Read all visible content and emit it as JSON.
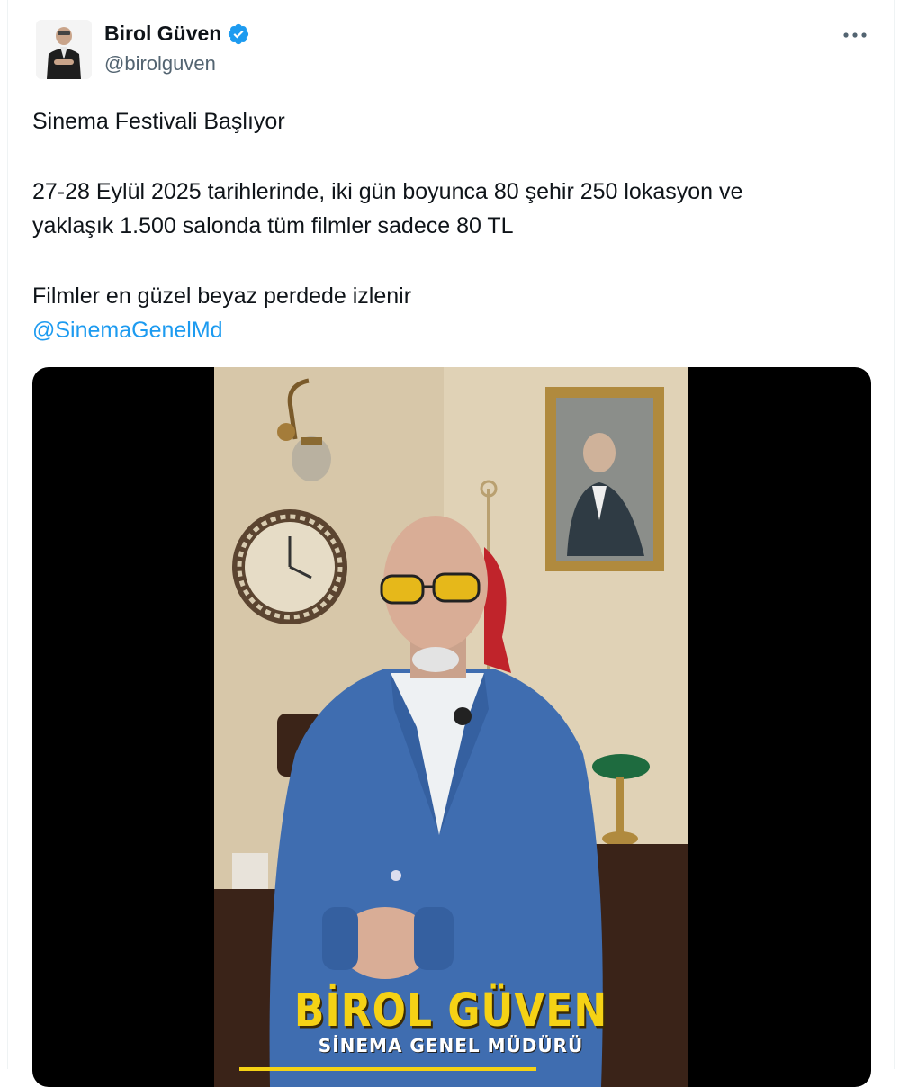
{
  "author": {
    "display_name": "Birol Güven",
    "handle": "@birolguven",
    "verified": true,
    "avatar_icon": "person-avatar-icon",
    "verified_icon": "verified-badge-icon"
  },
  "more_icon": "more-horizontal-icon",
  "tweet": {
    "line1": "Sinema Festivali Başlıyor",
    "line2a": "27-28 Eylül 2025 tarihlerinde, iki gün boyunca 80 şehir 250 lokasyon ve",
    "line2b": "yaklaşık 1.500 salonda tüm filmler sadece 80 TL",
    "line3": "Filmler en güzel beyaz perdede izlenir",
    "mention": "@SinemaGenelMd"
  },
  "video": {
    "overlay_name": "BİROL GÜVEN",
    "overlay_title": "SİNEMA GENEL MÜDÜRÜ"
  },
  "colors": {
    "text": "#0f1419",
    "secondary": "#536471",
    "accent": "#1d9bf0",
    "caption_yellow": "#f5d215"
  }
}
